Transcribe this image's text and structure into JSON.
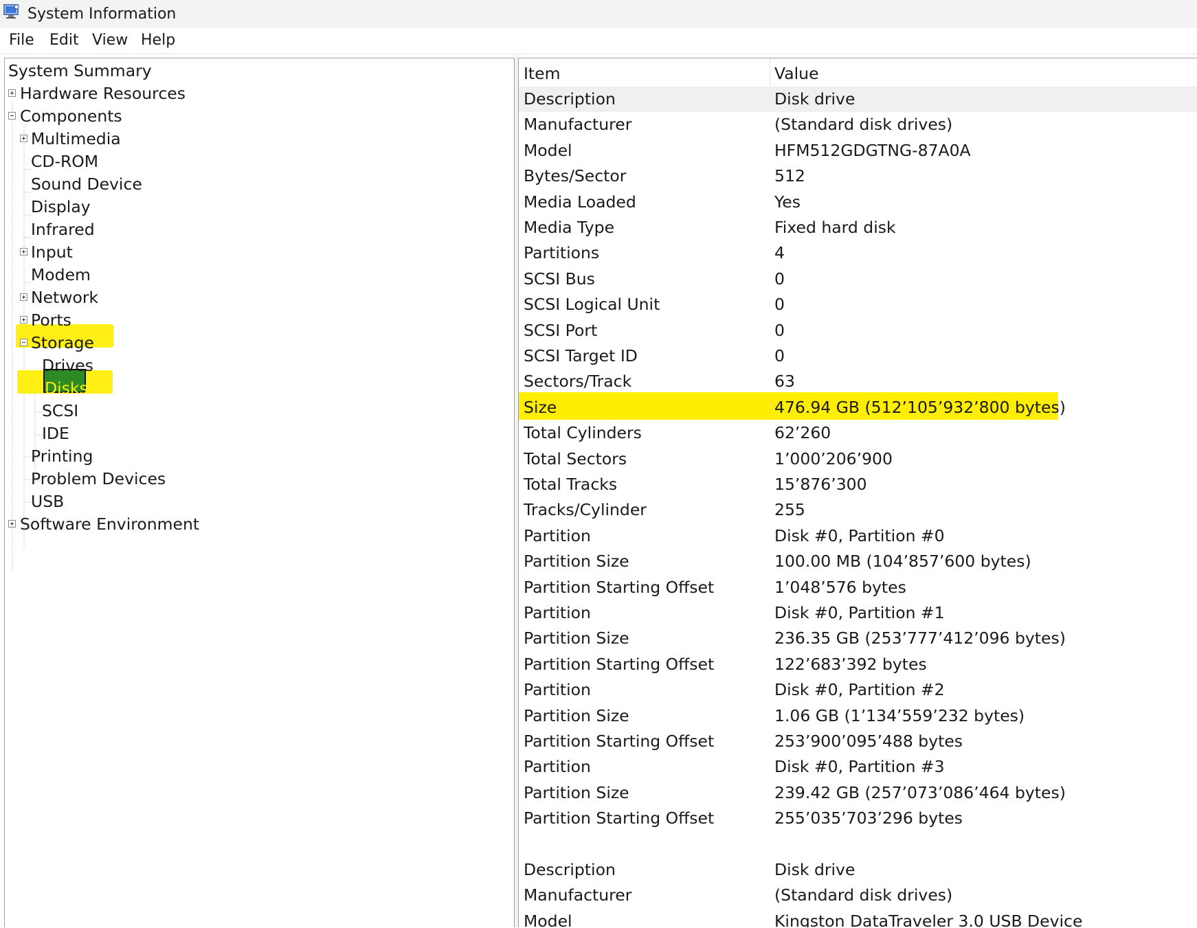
{
  "window": {
    "title": "System Information"
  },
  "menu": [
    "File",
    "Edit",
    "View",
    "Help"
  ],
  "tree": {
    "nodes": [
      {
        "label": "System Summary"
      },
      {
        "label": "Hardware Resources"
      },
      {
        "label": "Components"
      },
      {
        "label": "Multimedia"
      },
      {
        "label": "CD-ROM"
      },
      {
        "label": "Sound Device"
      },
      {
        "label": "Display"
      },
      {
        "label": "Infrared"
      },
      {
        "label": "Input"
      },
      {
        "label": "Modem"
      },
      {
        "label": "Network"
      },
      {
        "label": "Ports"
      },
      {
        "label": "Storage"
      },
      {
        "label": "Drives"
      },
      {
        "label": "Disks"
      },
      {
        "label": "SCSI"
      },
      {
        "label": "IDE"
      },
      {
        "label": "Printing"
      },
      {
        "label": "Problem Devices"
      },
      {
        "label": "USB"
      },
      {
        "label": "Software Environment"
      }
    ],
    "selected": "Disks"
  },
  "details": {
    "headers": {
      "item": "Item",
      "value": "Value"
    },
    "rows": [
      {
        "item": "Description",
        "value": "Disk drive"
      },
      {
        "item": "Manufacturer",
        "value": "(Standard disk drives)"
      },
      {
        "item": "Model",
        "value": "HFM512GDGTNG-87A0A"
      },
      {
        "item": "Bytes/Sector",
        "value": "512"
      },
      {
        "item": "Media Loaded",
        "value": "Yes"
      },
      {
        "item": "Media Type",
        "value": "Fixed hard disk"
      },
      {
        "item": "Partitions",
        "value": "4"
      },
      {
        "item": "SCSI Bus",
        "value": "0"
      },
      {
        "item": "SCSI Logical Unit",
        "value": "0"
      },
      {
        "item": "SCSI Port",
        "value": "0"
      },
      {
        "item": "SCSI Target ID",
        "value": "0"
      },
      {
        "item": "Sectors/Track",
        "value": "63"
      },
      {
        "item": "Size",
        "value": "476.94 GB (512’105’932’800 bytes)"
      },
      {
        "item": "Total Cylinders",
        "value": "62’260"
      },
      {
        "item": "Total Sectors",
        "value": "1’000’206’900"
      },
      {
        "item": "Total Tracks",
        "value": "15’876’300"
      },
      {
        "item": "Tracks/Cylinder",
        "value": "255"
      },
      {
        "item": "Partition",
        "value": "Disk #0, Partition #0"
      },
      {
        "item": "Partition Size",
        "value": "100.00 MB (104’857’600 bytes)"
      },
      {
        "item": "Partition Starting Offset",
        "value": "1’048’576 bytes"
      },
      {
        "item": "Partition",
        "value": "Disk #0, Partition #1"
      },
      {
        "item": "Partition Size",
        "value": "236.35 GB (253’777’412’096 bytes)"
      },
      {
        "item": "Partition Starting Offset",
        "value": "122’683’392 bytes"
      },
      {
        "item": "Partition",
        "value": "Disk #0, Partition #2"
      },
      {
        "item": "Partition Size",
        "value": "1.06 GB (1’134’559’232 bytes)"
      },
      {
        "item": "Partition Starting Offset",
        "value": "253’900’095’488 bytes"
      },
      {
        "item": "Partition",
        "value": "Disk #0, Partition #3"
      },
      {
        "item": "Partition Size",
        "value": "239.42 GB (257’073’086’464 bytes)"
      },
      {
        "item": "Partition Starting Offset",
        "value": "255’035’703’296 bytes"
      },
      {
        "item": "",
        "value": ""
      },
      {
        "item": "Description",
        "value": "Disk drive"
      },
      {
        "item": "Manufacturer",
        "value": "(Standard disk drives)"
      },
      {
        "item": "Model",
        "value": "Kingston DataTraveler 3.0 USB Device"
      }
    ],
    "highlighted_item": "Size"
  },
  "colors": {
    "highlight": "#ffee00",
    "selection": "#2d8a24"
  },
  "icons": {
    "app": "system-information-icon"
  }
}
